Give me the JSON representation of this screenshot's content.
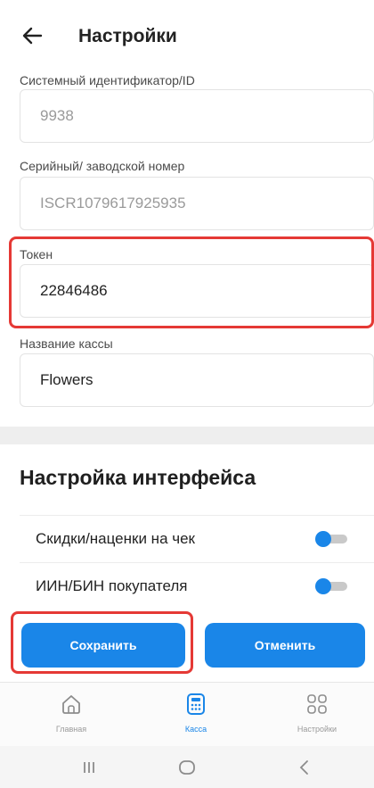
{
  "header": {
    "title": "Настройки",
    "back_icon": "arrow-left-icon"
  },
  "fields": [
    {
      "label": "Системный идентификатор/ID",
      "value": "9938",
      "state": "disabled"
    },
    {
      "label": "Серийный/ заводской номер",
      "value": "ISCR1079617925935",
      "state": "disabled"
    },
    {
      "label": "Токен",
      "value": "22846486",
      "state": "active"
    },
    {
      "label": "Название кассы",
      "value": "Flowers",
      "state": "active"
    }
  ],
  "interface_section": {
    "title": "Настройка интерфейса",
    "settings": [
      {
        "label": "Скидки/наценки на чек",
        "enabled": false
      },
      {
        "label": "ИИН/БИН покупателя",
        "enabled": false
      }
    ]
  },
  "actions": {
    "save_label": "Сохранить",
    "cancel_label": "Отменить"
  },
  "bottom_nav": {
    "items": [
      {
        "label": "Главная",
        "icon": "home-icon",
        "active": false
      },
      {
        "label": "Касса",
        "icon": "calculator-icon",
        "active": true
      },
      {
        "label": "Настройки",
        "icon": "grid-icon",
        "active": false
      }
    ]
  },
  "system_nav": {
    "icons": [
      "recent-apps-icon",
      "home-circle-icon",
      "back-chevron-icon"
    ]
  },
  "colors": {
    "accent": "#1a86e8",
    "highlight": "#e53935",
    "disabled_text": "#9a9a9a"
  }
}
